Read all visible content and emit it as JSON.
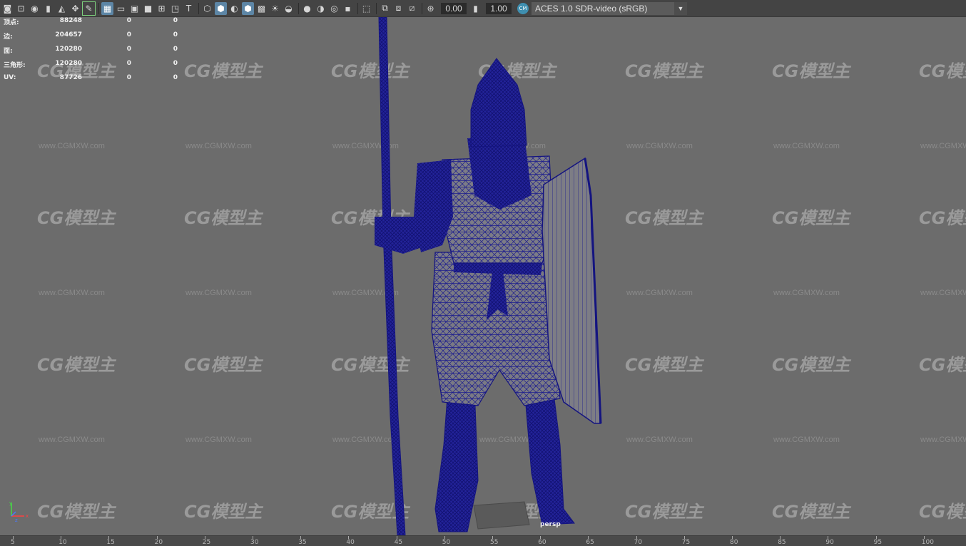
{
  "toolbar": {
    "icons": [
      "camera-select-icon",
      "camera-lock-icon",
      "camera-attributes-icon",
      "bookmark-icon",
      "image-plane-icon",
      "2d-pan-zoom-icon",
      "grease-pencil-icon",
      "grid-icon",
      "film-gate-icon",
      "resolution-gate-icon",
      "gate-mask-icon",
      "field-chart-icon",
      "safe-action-icon",
      "safe-title-icon",
      "wireframe-icon",
      "smooth-shade-icon",
      "use-default-material-icon",
      "wireframe-on-shaded-icon",
      "textured-icon",
      "use-all-lights-icon",
      "shadows-icon",
      "screen-space-ao-icon",
      "motion-blur-icon",
      "anti-aliasing-icon",
      "depth-of-field-icon",
      "isolate-select-icon",
      "xray-icon",
      "xray-joints-icon",
      "xray-components-icon",
      "exposure-reset-icon",
      "gamma-reset-icon"
    ],
    "exposure_value": "0.00",
    "gamma_value": "1.00",
    "colorspace_badge": "CM",
    "colorspace_value": "ACES 1.0 SDR-video (sRGB)"
  },
  "hud": {
    "rows": [
      {
        "label": "顶点:",
        "values": [
          "88248",
          "0",
          "0"
        ]
      },
      {
        "label": "边:",
        "values": [
          "204657",
          "0",
          "0"
        ]
      },
      {
        "label": "面:",
        "values": [
          "120280",
          "0",
          "0"
        ]
      },
      {
        "label": "三角形:",
        "values": [
          "120280",
          "0",
          "0"
        ]
      },
      {
        "label": "UV:",
        "values": [
          "87726",
          "0",
          "0"
        ]
      }
    ]
  },
  "watermark": {
    "logo_text": "CG模型主",
    "url_text": "www.CGMXW.com"
  },
  "viewport": {
    "camera_name": "persp",
    "axis_labels": [
      "y",
      "x",
      "z"
    ],
    "wire_color": "#1a1a8c",
    "background_color": "#6c6c6c"
  },
  "timeline": {
    "labels": [
      "5",
      "10",
      "15",
      "20",
      "25",
      "30",
      "35",
      "40",
      "45",
      "50",
      "55",
      "60",
      "65",
      "70",
      "75",
      "80",
      "85",
      "90",
      "95",
      "100"
    ]
  }
}
